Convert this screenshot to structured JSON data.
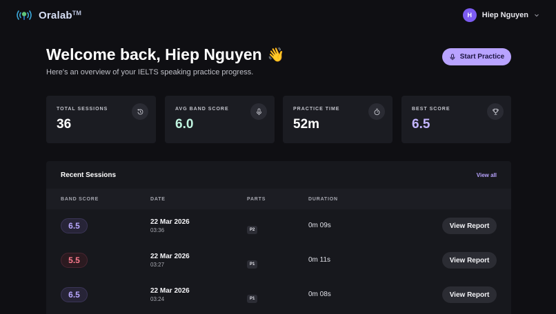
{
  "app": {
    "name": "Oralab",
    "tm": "TM"
  },
  "user": {
    "initial": "H",
    "name": "Hiep Nguyen"
  },
  "hero": {
    "title": "Welcome back, Hiep Nguyen",
    "emoji": "👋",
    "subtitle": "Here's an overview of your IELTS speaking practice progress.",
    "start_label": "Start Practice"
  },
  "stats": [
    {
      "label": "TOTAL SESSIONS",
      "value": "36",
      "icon": "history-icon"
    },
    {
      "label": "AVG BAND SCORE",
      "value": "6.0",
      "icon": "microphone-icon"
    },
    {
      "label": "PRACTICE TIME",
      "value": "52m",
      "icon": "stopwatch-icon"
    },
    {
      "label": "BEST SCORE",
      "value": "6.5",
      "icon": "trophy-icon"
    }
  ],
  "sessions": {
    "title": "Recent Sessions",
    "view_all": "View all",
    "columns": [
      "BAND SCORE",
      "DATE",
      "PARTS",
      "DURATION"
    ],
    "action_label": "View Report",
    "rows": [
      {
        "score": "6.5",
        "date": "22 Mar 2026",
        "time": "03:36",
        "part": "P2",
        "duration": "0m 09s"
      },
      {
        "score": "5.5",
        "date": "22 Mar 2026",
        "time": "03:27",
        "part": "P1",
        "duration": "0m 11s"
      },
      {
        "score": "6.5",
        "date": "22 Mar 2026",
        "time": "03:24",
        "part": "P1",
        "duration": "0m 08s"
      }
    ]
  },
  "colors": {
    "background": "#0f0f13",
    "card": "#1b1c22",
    "accent": "#b8a3ff",
    "avatar": "#7c5cf2",
    "mint": "#bff3df",
    "danger": "#ff7b8e"
  }
}
